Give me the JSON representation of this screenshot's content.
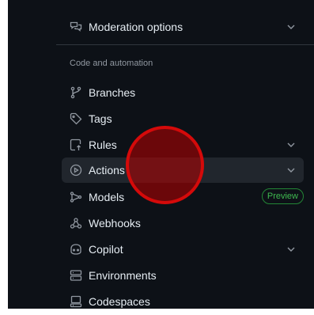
{
  "top_item": {
    "label": "Moderation options",
    "icon": "comment-discussion-icon",
    "has_chevron": true
  },
  "section": {
    "title": "Code and automation",
    "items": [
      {
        "label": "Branches",
        "icon": "git-branch-icon",
        "chevron": false
      },
      {
        "label": "Tags",
        "icon": "tag-icon",
        "chevron": false
      },
      {
        "label": "Rules",
        "icon": "repo-push-icon",
        "chevron": true
      },
      {
        "label": "Actions",
        "icon": "play-icon",
        "chevron": true,
        "active": true
      },
      {
        "label": "Models",
        "icon": "ai-model-icon",
        "chevron": false,
        "badge": "Preview"
      },
      {
        "label": "Webhooks",
        "icon": "webhook-icon",
        "chevron": false
      },
      {
        "label": "Copilot",
        "icon": "copilot-icon",
        "chevron": true
      },
      {
        "label": "Environments",
        "icon": "server-icon",
        "chevron": false
      },
      {
        "label": "Codespaces",
        "icon": "codespaces-icon",
        "chevron": false
      }
    ]
  },
  "colors": {
    "background": "#0d1117",
    "text": "#e6edf3",
    "muted": "#9198a1",
    "active_bg": "#21262d",
    "badge_green": "#3fb950",
    "cursor_red": "#d40a0a"
  }
}
